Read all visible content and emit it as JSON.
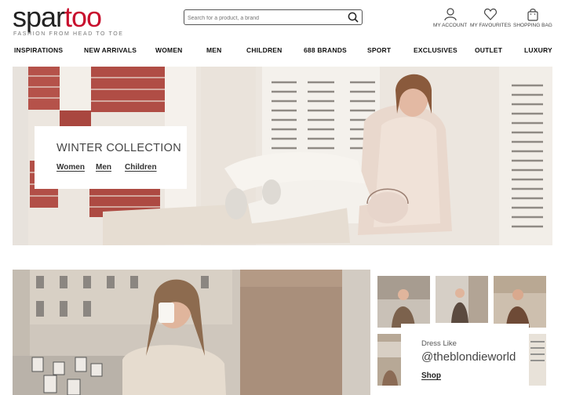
{
  "header": {
    "logo_part1": "spar",
    "logo_part2": "too",
    "tagline": "FASHION FROM HEAD TO TOE",
    "search_placeholder": "Search for a product, a brand",
    "account_label": "MY ACCOUNT",
    "favourites_label": "MY FAVOURITES",
    "bag_label": "SHOPPING BAG",
    "brand_color": "#c8102e"
  },
  "nav": {
    "items": [
      "INSPIRATIONS",
      "NEW ARRIVALS",
      "WOMEN",
      "MEN",
      "CHILDREN",
      "688 BRANDS",
      "SPORT",
      "EXCLUSIVES",
      "OUTLET",
      "LUXURY"
    ]
  },
  "hero": {
    "title": "WINTER COLLECTION",
    "links": [
      "Women",
      "Men",
      "Children"
    ]
  },
  "promo": {
    "small_label": "Dress Like",
    "handle": "@theblondieworld",
    "shop_label": "Shop"
  },
  "icons": [
    "search-icon",
    "account-icon",
    "heart-icon",
    "bag-icon"
  ]
}
